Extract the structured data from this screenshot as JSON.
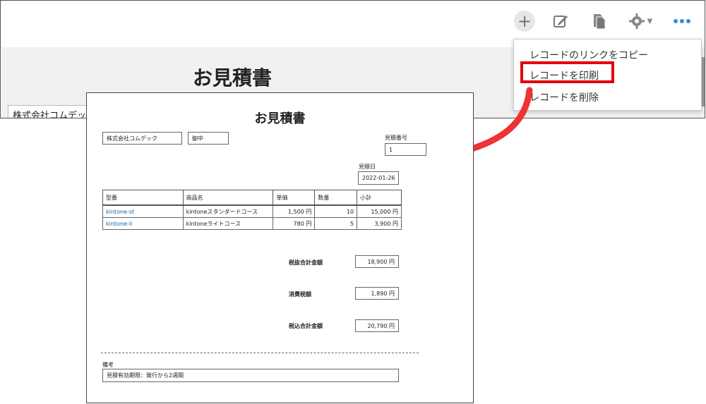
{
  "app": {
    "title": "お見積書",
    "company_partial": "株式会社コムデック"
  },
  "toolbar": {
    "add_icon": "plus-icon",
    "edit_icon": "pencil-icon",
    "copy_icon": "document-copy-icon",
    "settings_icon": "gear-icon",
    "more_icon": "ellipsis-icon"
  },
  "menu": {
    "items": [
      "レコードのリンクをコピー",
      "レコードを印刷",
      "レコードを削除"
    ]
  },
  "print_preview": {
    "title": "お見積書",
    "customer": "株式会社コムデック",
    "honorific": "御中",
    "quote_no_label": "見積番号",
    "quote_no": "1",
    "date_label": "見積日",
    "date": "2022-01-26",
    "columns": [
      "型番",
      "商品名",
      "単価",
      "数量",
      "小計"
    ],
    "rows": [
      [
        "kintone-st",
        "kintoneスタンダードコース",
        "1,500 円",
        "10",
        "15,000 円"
      ],
      [
        "kintone-li",
        "kintoneライトコース",
        "780 円",
        "5",
        "3,900 円"
      ]
    ],
    "subtotal_label": "税抜合計金額",
    "subtotal": "18,900 円",
    "tax_label": "消費税額",
    "tax": "1,890 円",
    "total_label": "税込合計金額",
    "total": "20,790 円",
    "remarks_label": "備考",
    "remarks": "見積有効期限：発行から2週間"
  },
  "colors": {
    "highlight": "#e3000f",
    "arrow": "#ee3333",
    "link": "#1f5da8"
  }
}
